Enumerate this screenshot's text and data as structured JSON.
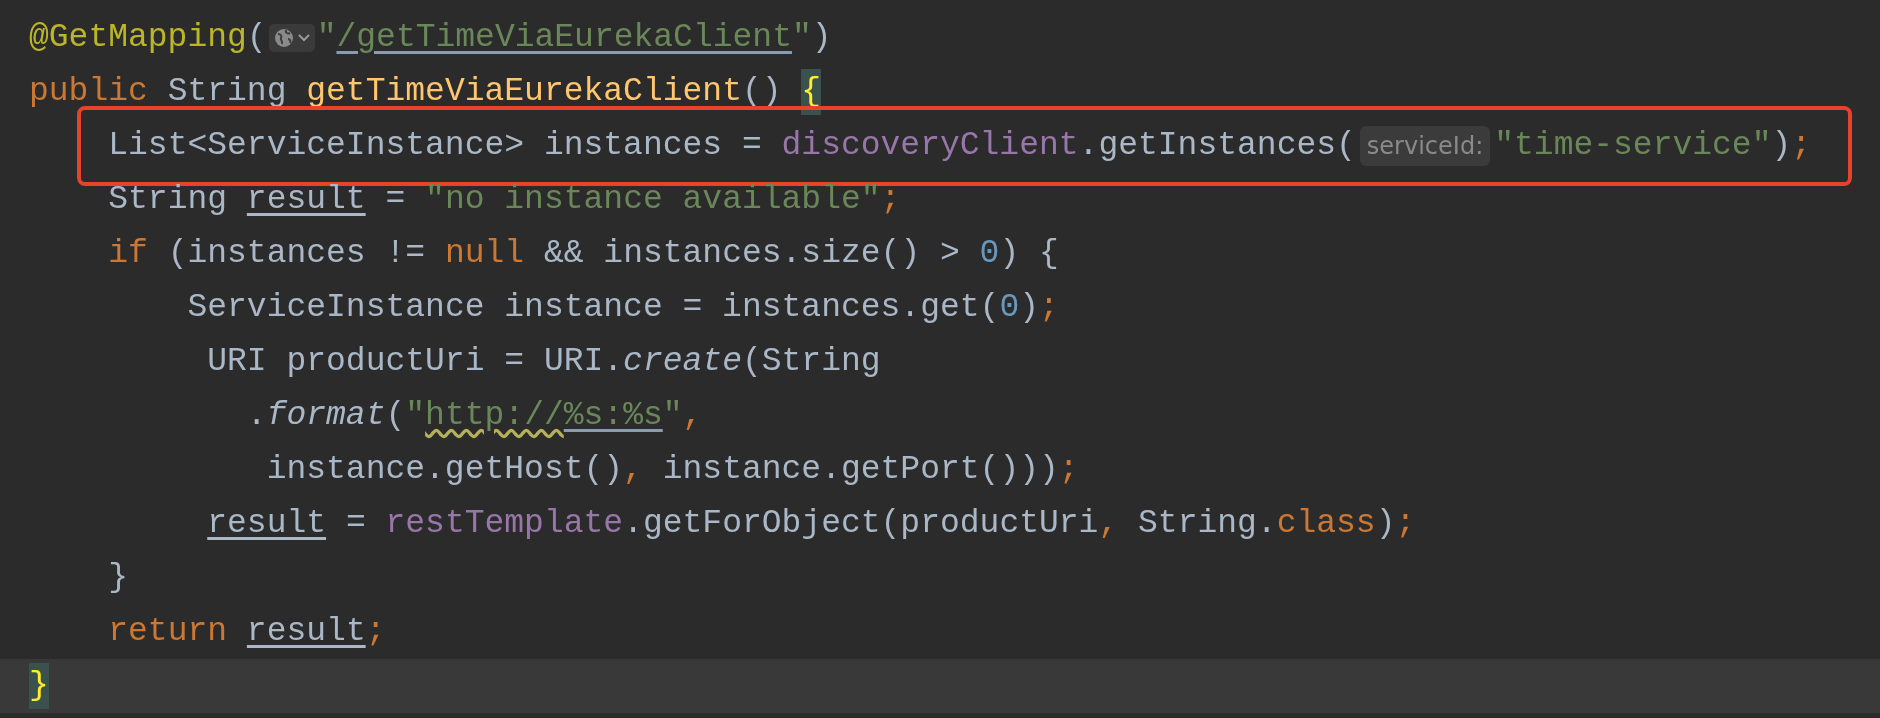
{
  "editor": {
    "lines": [
      {
        "current": false,
        "boxed": false,
        "tokens": [
          {
            "kind": "annotation",
            "text": "@GetMapping"
          },
          {
            "kind": "plain",
            "text": "("
          },
          {
            "kind": "globe"
          },
          {
            "kind": "string",
            "text": "\""
          },
          {
            "kind": "url",
            "text": "/getTimeViaEurekaClient"
          },
          {
            "kind": "string",
            "text": "\""
          },
          {
            "kind": "plain",
            "text": ")"
          }
        ]
      },
      {
        "current": false,
        "boxed": false,
        "tokens": [
          {
            "kind": "keyword",
            "text": "public"
          },
          {
            "kind": "plain",
            "text": " String "
          },
          {
            "kind": "method",
            "text": "getTimeViaEurekaClient"
          },
          {
            "kind": "plain",
            "text": "() "
          },
          {
            "kind": "brace",
            "text": "{"
          }
        ]
      },
      {
        "current": false,
        "boxed": true,
        "tokens": [
          {
            "kind": "plain",
            "text": "    List<ServiceInstance> instances = "
          },
          {
            "kind": "field",
            "text": "discoveryClient"
          },
          {
            "kind": "plain",
            "text": ".getInstances("
          },
          {
            "kind": "hint",
            "text": "serviceId:"
          },
          {
            "kind": "string",
            "text": "\"time-service\""
          },
          {
            "kind": "plain",
            "text": ")"
          },
          {
            "kind": "keyword",
            "text": ";"
          }
        ]
      },
      {
        "current": false,
        "boxed": false,
        "tokens": [
          {
            "kind": "plain",
            "text": "    String "
          },
          {
            "kind": "reassigned",
            "text": "result"
          },
          {
            "kind": "plain",
            "text": " = "
          },
          {
            "kind": "string",
            "text": "\"no instance available\""
          },
          {
            "kind": "keyword",
            "text": ";"
          }
        ]
      },
      {
        "current": false,
        "boxed": false,
        "tokens": [
          {
            "kind": "keyword",
            "text": "    if"
          },
          {
            "kind": "plain",
            "text": " (instances != "
          },
          {
            "kind": "keyword",
            "text": "null"
          },
          {
            "kind": "plain",
            "text": " && instances.size() > "
          },
          {
            "kind": "number",
            "text": "0"
          },
          {
            "kind": "plain",
            "text": ") {"
          }
        ]
      },
      {
        "current": false,
        "boxed": false,
        "tokens": [
          {
            "kind": "plain",
            "text": "        ServiceInstance instance = instances.get("
          },
          {
            "kind": "number",
            "text": "0"
          },
          {
            "kind": "plain",
            "text": ")"
          },
          {
            "kind": "keyword",
            "text": ";"
          }
        ]
      },
      {
        "current": false,
        "boxed": false,
        "tokens": [
          {
            "kind": "plain",
            "text": "         URI productUri = URI."
          },
          {
            "kind": "static",
            "text": "create"
          },
          {
            "kind": "plain",
            "text": "(String"
          }
        ]
      },
      {
        "current": false,
        "boxed": false,
        "tokens": [
          {
            "kind": "plain",
            "text": "           ."
          },
          {
            "kind": "static",
            "text": "format"
          },
          {
            "kind": "plain",
            "text": "("
          },
          {
            "kind": "string",
            "text": "\""
          },
          {
            "kind": "url_warning",
            "text": "http://"
          },
          {
            "kind": "url",
            "text": "%s:%s"
          },
          {
            "kind": "string",
            "text": "\""
          },
          {
            "kind": "keyword",
            "text": ","
          }
        ]
      },
      {
        "current": false,
        "boxed": false,
        "tokens": [
          {
            "kind": "plain",
            "text": "            instance.getHost()"
          },
          {
            "kind": "keyword",
            "text": ","
          },
          {
            "kind": "plain",
            "text": " instance.getPort()))"
          },
          {
            "kind": "keyword",
            "text": ";"
          }
        ]
      },
      {
        "current": false,
        "boxed": false,
        "tokens": [
          {
            "kind": "reassigned",
            "text": "         result"
          },
          {
            "kind": "plain",
            "text": " = "
          },
          {
            "kind": "field",
            "text": "restTemplate"
          },
          {
            "kind": "plain",
            "text": ".getForObject(productUri"
          },
          {
            "kind": "keyword",
            "text": ","
          },
          {
            "kind": "plain",
            "text": " String."
          },
          {
            "kind": "keyword",
            "text": "class"
          },
          {
            "kind": "plain",
            "text": ")"
          },
          {
            "kind": "keyword",
            "text": ";"
          }
        ]
      },
      {
        "current": false,
        "boxed": false,
        "tokens": [
          {
            "kind": "plain",
            "text": "    }"
          }
        ]
      },
      {
        "current": false,
        "boxed": false,
        "tokens": [
          {
            "kind": "keyword",
            "text": "    return"
          },
          {
            "kind": "reassigned",
            "text": " result"
          },
          {
            "kind": "keyword",
            "text": ";"
          }
        ]
      },
      {
        "current": true,
        "boxed": false,
        "tokens": [
          {
            "kind": "brace",
            "text": "}"
          }
        ]
      }
    ]
  }
}
